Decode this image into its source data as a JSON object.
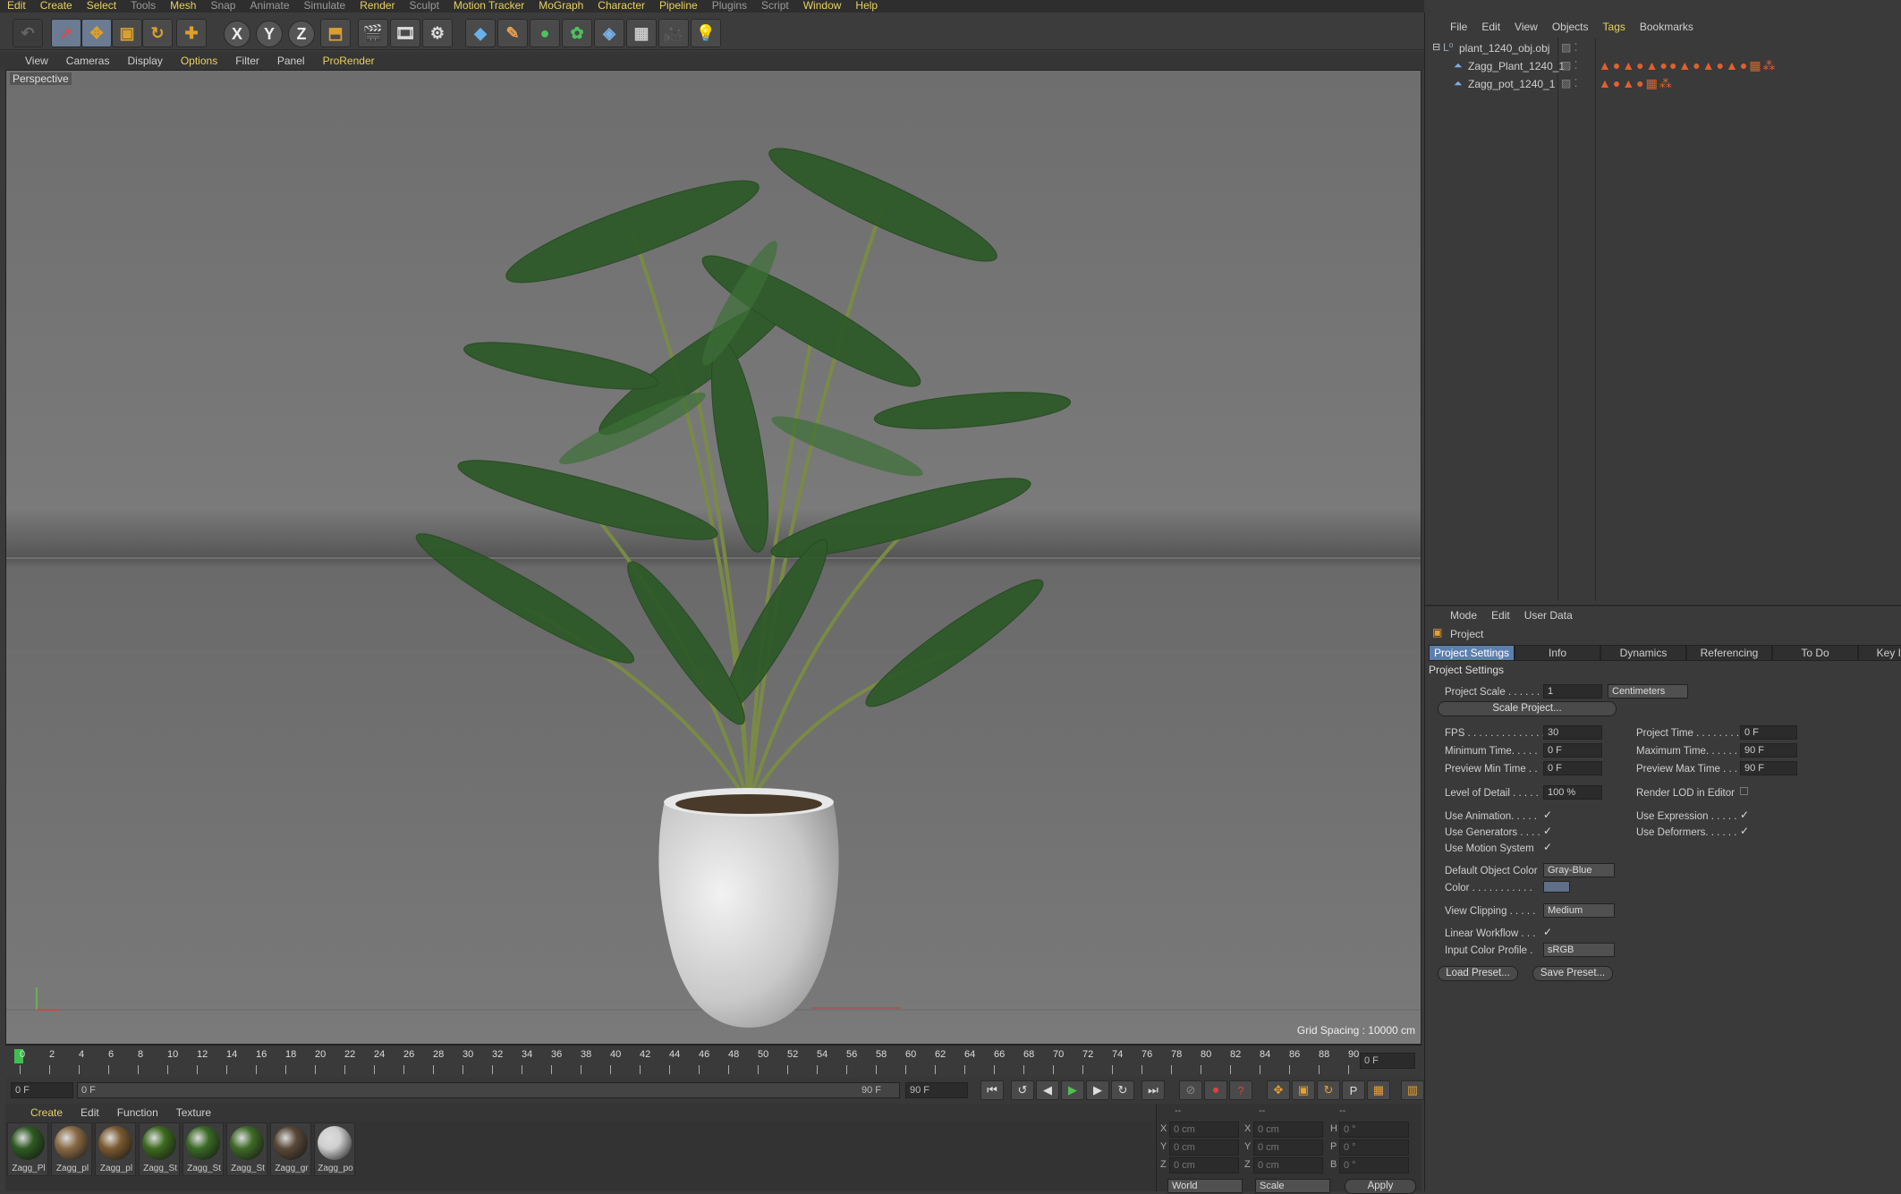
{
  "menubar": [
    "Edit",
    "Create",
    "Select",
    "Tools",
    "Mesh",
    "Snap",
    "Animate",
    "Simulate",
    "Render",
    "Sculpt",
    "Motion Tracker",
    "MoGraph",
    "Character",
    "Pipeline",
    "Plugins",
    "Script",
    "Window",
    "Help"
  ],
  "toolbar": {
    "x": "X",
    "y": "Y",
    "z": "Z"
  },
  "viewport_menu": [
    "View",
    "Cameras",
    "Display",
    "Options",
    "Filter",
    "Panel",
    "ProRender"
  ],
  "viewport": {
    "label": "Perspective",
    "grid_spacing": "Grid Spacing : 10000 cm"
  },
  "timeline": {
    "ticks": [
      "0",
      "2",
      "4",
      "6",
      "8",
      "10",
      "12",
      "14",
      "16",
      "18",
      "20",
      "22",
      "24",
      "26",
      "28",
      "30",
      "32",
      "34",
      "36",
      "38",
      "40",
      "42",
      "44",
      "46",
      "48",
      "50",
      "52",
      "54",
      "56",
      "58",
      "60",
      "62",
      "64",
      "66",
      "68",
      "70",
      "72",
      "74",
      "76",
      "78",
      "80",
      "82",
      "84",
      "86",
      "88",
      "90"
    ],
    "current": "0 F"
  },
  "transport": {
    "start": "0 F",
    "range_start": "0 F",
    "range_end": "90 F",
    "end": "90 F"
  },
  "material_menu": [
    "Create",
    "Edit",
    "Function",
    "Texture"
  ],
  "materials": [
    {
      "label": "Zagg_Pl",
      "color": "#2e5a22"
    },
    {
      "label": "Zagg_pl",
      "color": "#8a6a45"
    },
    {
      "label": "Zagg_pl",
      "color": "#7a5a30"
    },
    {
      "label": "Zagg_St",
      "color": "#3d6a1f"
    },
    {
      "label": "Zagg_St",
      "color": "#3a6a25"
    },
    {
      "label": "Zagg_St",
      "color": "#3f6a28"
    },
    {
      "label": "Zagg_gr",
      "color": "#5a4838"
    },
    {
      "label": "Zagg_po",
      "color": "#cfcfcf"
    }
  ],
  "coords": {
    "header": [
      "--",
      "--",
      "--"
    ],
    "rows": [
      {
        "a": "X",
        "av": "0 cm",
        "b": "X",
        "bv": "0 cm",
        "c": "H",
        "cv": "0 °"
      },
      {
        "a": "Y",
        "av": "0 cm",
        "b": "Y",
        "bv": "0 cm",
        "c": "P",
        "cv": "0 °"
      },
      {
        "a": "Z",
        "av": "0 cm",
        "b": "Z",
        "bv": "0 cm",
        "c": "B",
        "cv": "0 °"
      }
    ],
    "world": "World",
    "scale": "Scale",
    "apply": "Apply"
  },
  "object_menu": [
    "File",
    "Edit",
    "View",
    "Objects",
    "Tags",
    "Bookmarks"
  ],
  "objects": [
    {
      "name": "plant_1240_obj.obj"
    },
    {
      "name": "Zagg_Plant_1240_1"
    },
    {
      "name": "Zagg_pot_1240_1"
    }
  ],
  "attr_menu": [
    "Mode",
    "Edit",
    "User Data"
  ],
  "attr_title": "Project",
  "tabs": [
    "Project Settings",
    "Info",
    "Dynamics",
    "Referencing",
    "To Do",
    "Key Interp"
  ],
  "section": "Project Settings",
  "props": {
    "project_scale": "Project Scale . . . . . .",
    "project_scale_val": "1",
    "units": "Centimeters",
    "scale_project": "Scale Project...",
    "fps": "FPS . . . . . . . . . . . . . .",
    "fps_val": "30",
    "project_time": "Project Time . . . . . . . .",
    "project_time_val": "0 F",
    "min_time": "Minimum Time. . . . .",
    "min_time_val": "0 F",
    "max_time": "Maximum Time. . . . . .",
    "max_time_val": "90 F",
    "pmin": "Preview Min Time . .",
    "pmin_val": "0 F",
    "pmax": "Preview Max Time . . .",
    "pmax_val": "90 F",
    "lod": "Level of Detail . . . . .",
    "lod_val": "100 %",
    "render_lod": "Render LOD in Editor",
    "use_anim": "Use Animation. . . . .",
    "use_expr": "Use Expression . . . . .",
    "use_gen": "Use Generators . . . .",
    "use_def": "Use Deformers. . . . . .",
    "use_motion": "Use Motion System",
    "default_color": "Default Object Color",
    "default_color_val": "Gray-Blue",
    "color": "Color . . . . . . . . . . .",
    "view_clip": "View Clipping . . . . .",
    "view_clip_val": "Medium",
    "linear": "Linear Workflow . . .",
    "input_profile": "Input Color Profile .",
    "input_profile_val": "sRGB",
    "load_preset": "Load Preset...",
    "save_preset": "Save Preset..."
  }
}
